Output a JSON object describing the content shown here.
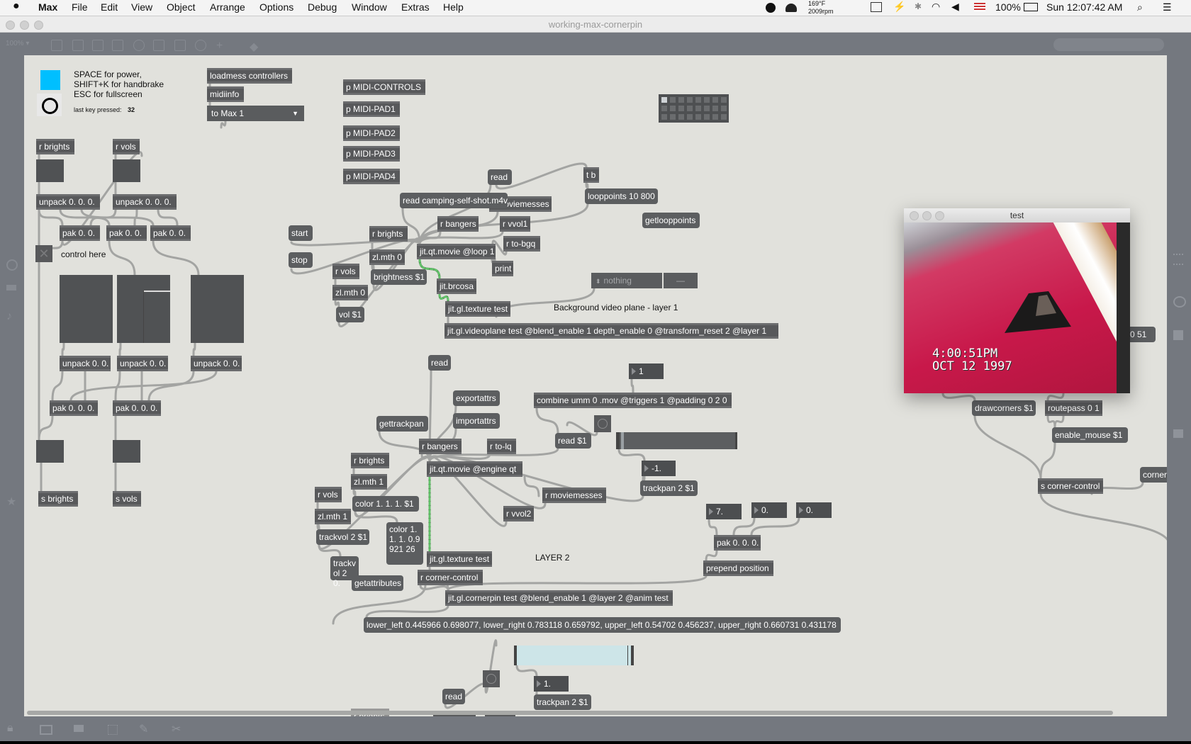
{
  "menubar": {
    "app": "Max",
    "items": [
      "File",
      "Edit",
      "View",
      "Object",
      "Arrange",
      "Options",
      "Debug",
      "Window",
      "Extras",
      "Help"
    ],
    "temp": "169°F",
    "rpm": "2009rpm",
    "battery": "100%",
    "clock": "Sun 12:07:42 AM"
  },
  "window": {
    "title": "working-max-cornerpin",
    "zoom": "100% ▾"
  },
  "patch": {
    "accent_color": "#00bfff",
    "instructions": [
      "SPACE for power,",
      "SHIFT+K for handbrake",
      "ESC for fullscreen"
    ],
    "last_key_label": "last key pressed:",
    "last_key_value": "32",
    "control_here": "control here",
    "bg_comment": "Background video plane - layer 1",
    "layer2_comment": "LAYER 2",
    "umenu_midi": "to Max 1",
    "umenu_nothing": "nothing",
    "umenu_dash": "—",
    "objects": [
      {
        "text": "loadmess controllers",
        "type": "object"
      },
      {
        "text": "midiinfo",
        "type": "object"
      },
      {
        "text": "p MIDI-CONTROLS",
        "type": "object"
      },
      {
        "text": "p MIDI-PAD1",
        "type": "object"
      },
      {
        "text": "p MIDI-PAD2",
        "type": "object"
      },
      {
        "text": "p MIDI-PAD3",
        "type": "object"
      },
      {
        "text": "p MIDI-PAD4",
        "type": "object"
      },
      {
        "text": "r brights",
        "type": "object"
      },
      {
        "text": "r vols",
        "type": "object"
      },
      {
        "text": "unpack 0. 0. 0.",
        "type": "object"
      },
      {
        "text": "unpack 0. 0. 0.",
        "type": "object"
      },
      {
        "text": "pak 0. 0.",
        "type": "object"
      },
      {
        "text": "pak 0. 0.",
        "type": "object"
      },
      {
        "text": "pak 0. 0.",
        "type": "object"
      },
      {
        "text": "unpack 0. 0.",
        "type": "object"
      },
      {
        "text": "unpack 0. 0.",
        "type": "object"
      },
      {
        "text": "unpack 0. 0.",
        "type": "object"
      },
      {
        "text": "pak 0. 0. 0.",
        "type": "object"
      },
      {
        "text": "pak 0. 0. 0.",
        "type": "object"
      },
      {
        "text": "s brights",
        "type": "object"
      },
      {
        "text": "s vols",
        "type": "object"
      },
      {
        "text": "start",
        "type": "message"
      },
      {
        "text": "stop",
        "type": "message"
      },
      {
        "text": "read",
        "type": "message"
      },
      {
        "text": "t b",
        "type": "object"
      },
      {
        "text": "r moviemesses",
        "type": "object"
      },
      {
        "text": "read camping-self-shot.m4v",
        "type": "message"
      },
      {
        "text": "looppoints 10 800",
        "type": "message"
      },
      {
        "text": "getlooppoints",
        "type": "message"
      },
      {
        "text": "r bangers",
        "type": "object"
      },
      {
        "text": "r vvol1",
        "type": "object"
      },
      {
        "text": "r brights",
        "type": "object"
      },
      {
        "text": "jit.qt.movie @loop 1",
        "type": "object"
      },
      {
        "text": "r to-bgq",
        "type": "object"
      },
      {
        "text": "zl.mth 0",
        "type": "object"
      },
      {
        "text": "print",
        "type": "object"
      },
      {
        "text": "r vols",
        "type": "object"
      },
      {
        "text": "brightness $1",
        "type": "message"
      },
      {
        "text": "zl.mth 0",
        "type": "object"
      },
      {
        "text": "jit.brcosa",
        "type": "object"
      },
      {
        "text": "vol $1",
        "type": "message"
      },
      {
        "text": "jit.gl.texture test",
        "type": "object"
      },
      {
        "text": "jit.gl.videoplane test @blend_enable 1 depth_enable 0 @transform_reset 2 @layer 1",
        "type": "object"
      },
      {
        "text": "read",
        "type": "message"
      },
      {
        "text": "exportattrs",
        "type": "message"
      },
      {
        "text": "combine umm 0 .mov @triggers 1 @padding 0 2 0",
        "type": "object"
      },
      {
        "text": "gettrackpan",
        "type": "message"
      },
      {
        "text": "importattrs",
        "type": "message"
      },
      {
        "text": "read $1",
        "type": "message"
      },
      {
        "text": "r bangers",
        "type": "object"
      },
      {
        "text": "r to-lq",
        "type": "object"
      },
      {
        "text": "r brights",
        "type": "object"
      },
      {
        "text": "jit.qt.movie @engine qt",
        "type": "object"
      },
      {
        "text": "zl.mth 1",
        "type": "object"
      },
      {
        "text": "trackpan 2 $1",
        "type": "message"
      },
      {
        "text": "r vols",
        "type": "object"
      },
      {
        "text": "r moviemesses",
        "type": "object"
      },
      {
        "text": "color 1. 1. 1. $1",
        "type": "message"
      },
      {
        "text": "r vvol2",
        "type": "object"
      },
      {
        "text": "zl.mth 1",
        "type": "object"
      },
      {
        "text": "color 1. 1. 1. 0.9921 26",
        "type": "message"
      },
      {
        "text": "trackvol 2 $1",
        "type": "message"
      },
      {
        "text": "pak 0. 0. 0.",
        "type": "object"
      },
      {
        "text": "jit.gl.texture test",
        "type": "object"
      },
      {
        "text": "trackvol 2 0.",
        "type": "message"
      },
      {
        "text": "prepend position",
        "type": "object"
      },
      {
        "text": "getattributes",
        "type": "message"
      },
      {
        "text": "r corner-control",
        "type": "object"
      },
      {
        "text": "jit.gl.cornerpin test @blend_enable 1 @layer 2 @anim test",
        "type": "object"
      },
      {
        "text": "lower_left 0.445966 0.698077, lower_right 0.783118 0.659792, upper_left 0.54702 0.456237, upper_right 0.660731 0.431178",
        "type": "message"
      },
      {
        "text": "read",
        "type": "message"
      },
      {
        "text": "trackpan 2 $1",
        "type": "message"
      },
      {
        "text": "r brights",
        "type": "object"
      },
      {
        "text": "drawcorners $1",
        "type": "message"
      },
      {
        "text": "routepass 0 1",
        "type": "object"
      },
      {
        "text": "enable_mouse $1",
        "type": "message"
      },
      {
        "text": "s corner-control",
        "type": "object"
      },
      {
        "text": "corner",
        "type": "message"
      },
      {
        "text": "0 51",
        "type": "message"
      }
    ],
    "numbers": [
      "1",
      "-1.",
      "7.",
      "0.",
      "0.",
      "1."
    ]
  },
  "video_window": {
    "title": "test",
    "overlay_time": "4:00:51PM",
    "overlay_date": "OCT 12 1997"
  }
}
